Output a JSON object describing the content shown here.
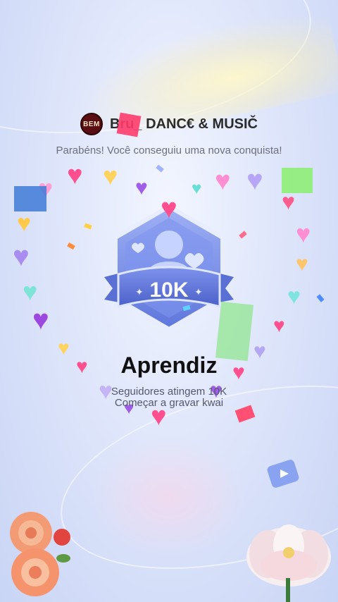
{
  "header": {
    "avatar_text": "BEM",
    "username": "Bru_ DANC€ & MUSIČ"
  },
  "subtitle": "Parabéns! Você conseguiu uma nova conquista!",
  "badge": {
    "label": "10K",
    "icon": "user-badge-icon"
  },
  "achievement": {
    "title": "Aprendiz",
    "line1": "Seguidores atingem 10K",
    "line2": "Começar a gravar kwai"
  },
  "colors": {
    "badge_blue": "#6f86e6",
    "heart_pink": "#ff5fa2",
    "heart_purple": "#9c5ee8"
  }
}
